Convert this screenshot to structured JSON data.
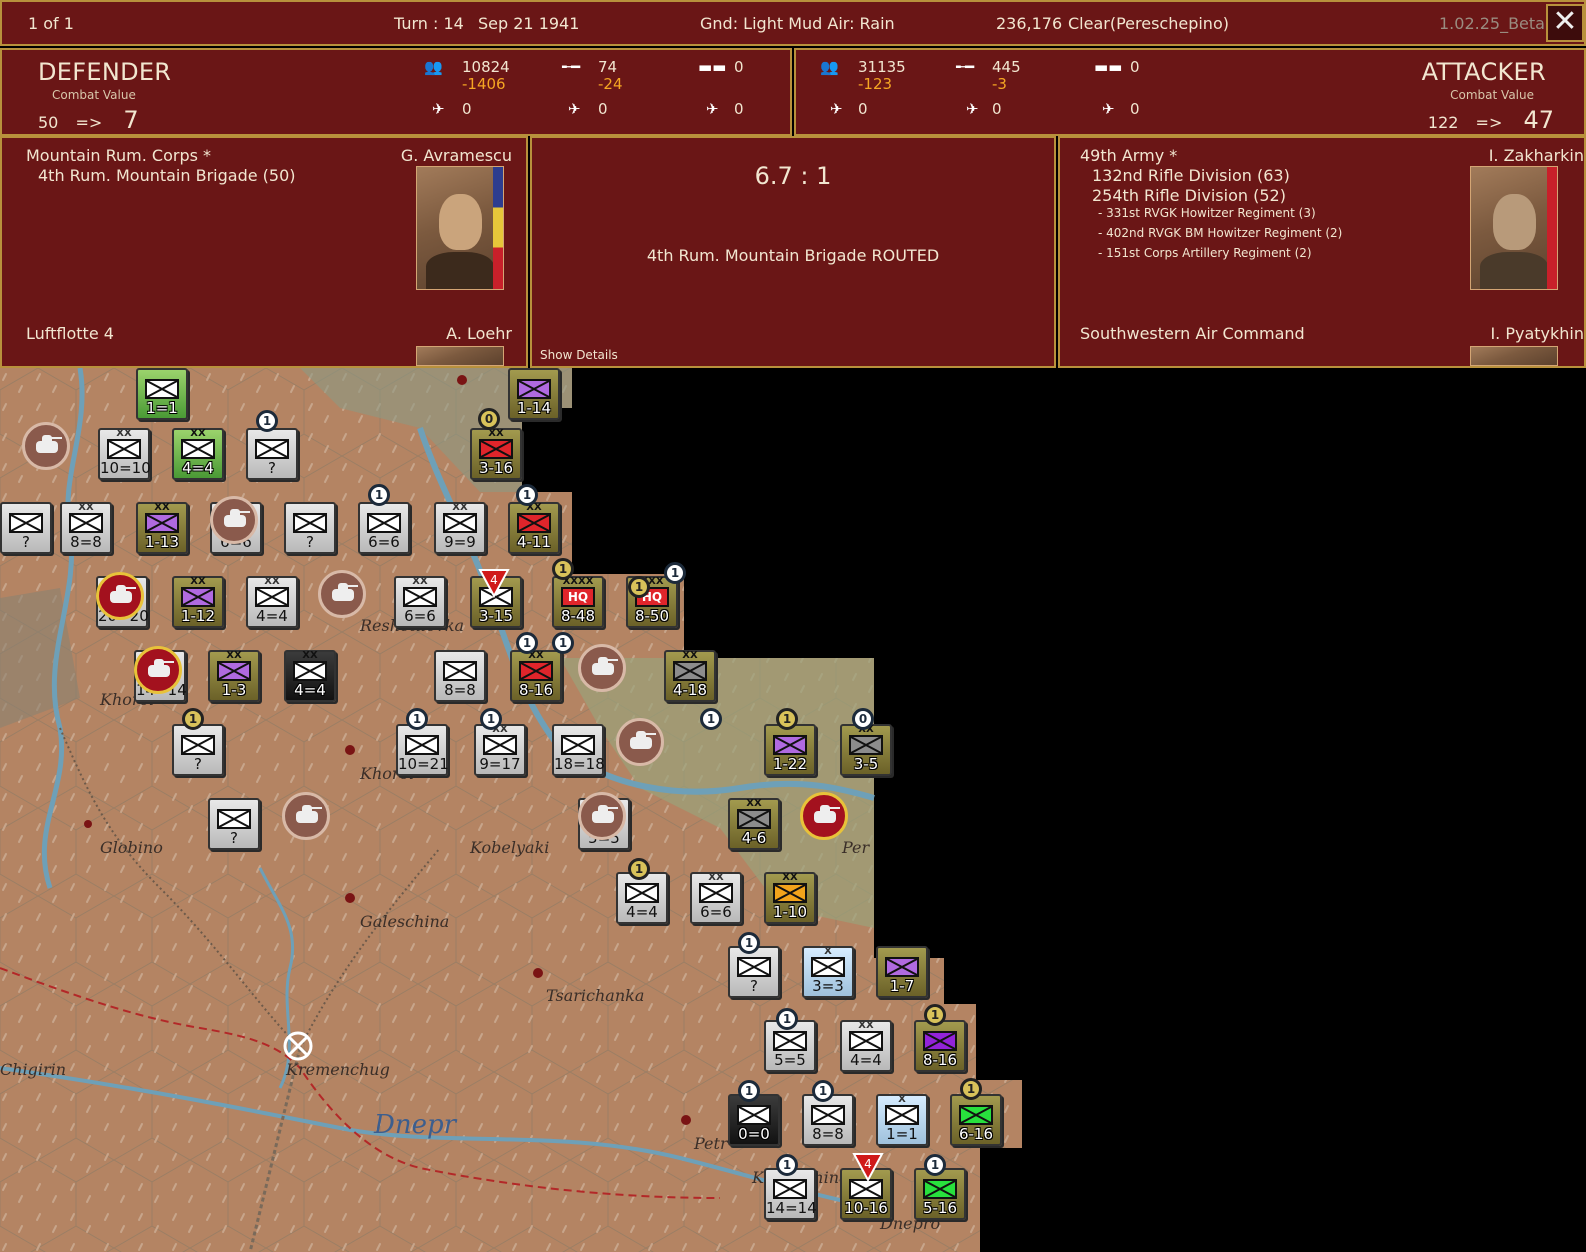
{
  "top_bar": {
    "page_info": "1 of 1",
    "turn": "Turn : 14",
    "date": "Sep 21 1941",
    "weather": "Gnd: Light Mud  Air: Rain",
    "score": "236,176",
    "location": "Clear(Pereschepino)",
    "version": "1.02.25_Beta",
    "close_label": "✕"
  },
  "defender": {
    "title": "DEFENDER",
    "cv_label": "Combat Value",
    "cv_before": "50",
    "arrow": "=>",
    "cv_after": "7",
    "men": "10824",
    "men_loss": "-1406",
    "guns": "74",
    "guns_loss": "-24",
    "afv": "0",
    "air1": "0",
    "air2": "0",
    "air3": "0"
  },
  "attacker": {
    "title": "ATTACKER",
    "cv_label": "Combat Value",
    "cv_before": "122",
    "arrow": "=>",
    "cv_after": "47",
    "men": "31135",
    "men_loss": "-123",
    "guns": "445",
    "guns_loss": "-3",
    "afv": "0",
    "air1": "0",
    "air2": "0",
    "air3": "0"
  },
  "defender_forces": {
    "hq": "Mountain Rum. Corps *",
    "commander": "G. Avramescu",
    "units": [
      "4th Rum. Mountain Brigade (50)"
    ],
    "air_hq": "Luftflotte 4",
    "air_commander": "A. Loehr"
  },
  "result": {
    "odds": "6.7 : 1",
    "outcome": "4th Rum. Mountain Brigade ROUTED",
    "details_link": "Show Details"
  },
  "attacker_forces": {
    "hq": "49th Army *",
    "commander": "I. Zakharkin",
    "units": [
      "132nd Rifle Division (63)",
      "254th Rifle Division (52)"
    ],
    "support": [
      "- 331st RVGK Howitzer Regiment (3)",
      "- 402nd RVGK BM Howitzer Regiment (2)",
      "- 151st Corps Artillery Regiment (2)"
    ],
    "air_hq": "Southwestern Air Command",
    "air_commander": "I. Pyatykhin"
  },
  "map": {
    "places": [
      "Globino",
      "Kobelyaki",
      "Galeschina",
      "Tsarichanka",
      "Kremenchug",
      "Dnepr",
      "Khorol",
      "Reshetilovka",
      "Khorol",
      "Chigirin",
      "Petr",
      "Per",
      "Kozelschina",
      "Dnepro"
    ],
    "counters": [
      {
        "value": "1=1",
        "style": "green",
        "fill": "white",
        "size": ""
      },
      {
        "value": "1-14",
        "style": "olive",
        "fill": "purple",
        "size": ""
      },
      {
        "value": "10=10",
        "style": "grey",
        "fill": "white",
        "size": "XX"
      },
      {
        "value": "4=4",
        "style": "green",
        "fill": "white",
        "size": "XX"
      },
      {
        "value": "?",
        "style": "grey",
        "fill": "white",
        "size": ""
      },
      {
        "value": "3-16",
        "style": "olive",
        "fill": "red",
        "size": "XX"
      },
      {
        "value": "?",
        "style": "grey",
        "fill": "white",
        "size": ""
      },
      {
        "value": "8=8",
        "style": "grey",
        "fill": "white",
        "size": "XX"
      },
      {
        "value": "1-13",
        "style": "olive",
        "fill": "purple",
        "size": "XX"
      },
      {
        "value": "6=6",
        "style": "grey",
        "fill": "white",
        "size": "XX"
      },
      {
        "value": "?",
        "style": "grey",
        "fill": "white",
        "size": ""
      },
      {
        "value": "6=6",
        "style": "grey",
        "fill": "white",
        "size": ""
      },
      {
        "value": "9=9",
        "style": "grey",
        "fill": "white",
        "size": "XX"
      },
      {
        "value": "4-11",
        "style": "olive",
        "fill": "red",
        "size": "XX"
      },
      {
        "value": "20=20",
        "style": "grey",
        "fill": "white",
        "size": ""
      },
      {
        "value": "1-12",
        "style": "olive",
        "fill": "purple",
        "size": "XX"
      },
      {
        "value": "4=4",
        "style": "grey",
        "fill": "white",
        "size": "XX"
      },
      {
        "value": "6=6",
        "style": "grey",
        "fill": "white",
        "size": "XX"
      },
      {
        "value": "3-15",
        "style": "olive",
        "fill": "white",
        "size": ""
      },
      {
        "value": "8-48",
        "style": "olive",
        "fill": "hq",
        "size": "XXXX"
      },
      {
        "value": "8-50",
        "style": "olive",
        "fill": "hq",
        "size": "XXX"
      },
      {
        "value": "14=14",
        "style": "grey",
        "fill": "white",
        "size": ""
      },
      {
        "value": "1-3",
        "style": "olive",
        "fill": "purple",
        "size": "XX"
      },
      {
        "value": "4=4",
        "style": "dark",
        "fill": "white",
        "size": "XX"
      },
      {
        "value": "8=8",
        "style": "grey",
        "fill": "white",
        "size": ""
      },
      {
        "value": "8-16",
        "style": "olive",
        "fill": "red",
        "size": "XX"
      },
      {
        "value": "4-18",
        "style": "olive",
        "fill": "grey",
        "size": "XX"
      },
      {
        "value": "?",
        "style": "grey",
        "fill": "white",
        "size": ""
      },
      {
        "value": "10=21",
        "style": "grey",
        "fill": "white",
        "size": ""
      },
      {
        "value": "9=17",
        "style": "grey",
        "fill": "white",
        "size": "XX"
      },
      {
        "value": "18=18",
        "style": "grey",
        "fill": "white",
        "size": ""
      },
      {
        "value": "1-22",
        "style": "olive",
        "fill": "purple",
        "size": ""
      },
      {
        "value": "3-5",
        "style": "olive",
        "fill": "grey",
        "size": "XX"
      },
      {
        "value": "?",
        "style": "grey",
        "fill": "white",
        "size": ""
      },
      {
        "value": "5=5",
        "style": "grey",
        "fill": "white",
        "size": ""
      },
      {
        "value": "4-6",
        "style": "olive",
        "fill": "grey",
        "size": "XX"
      },
      {
        "value": "4=4",
        "style": "grey",
        "fill": "white",
        "size": ""
      },
      {
        "value": "6=6",
        "style": "grey",
        "fill": "white",
        "size": "XX"
      },
      {
        "value": "1-10",
        "style": "olive",
        "fill": "orange",
        "size": "XX"
      },
      {
        "value": "?",
        "style": "grey",
        "fill": "white",
        "size": ""
      },
      {
        "value": "3=3",
        "style": "light",
        "fill": "white",
        "size": "X"
      },
      {
        "value": "1-7",
        "style": "olive",
        "fill": "purple",
        "size": ""
      },
      {
        "value": "5=5",
        "style": "grey",
        "fill": "white",
        "size": ""
      },
      {
        "value": "4=4",
        "style": "grey",
        "fill": "white",
        "size": "XX"
      },
      {
        "value": "8-16",
        "style": "olive",
        "fill": "violet",
        "size": ""
      },
      {
        "value": "0=0",
        "style": "dark",
        "fill": "white",
        "size": ""
      },
      {
        "value": "8=8",
        "style": "grey",
        "fill": "white",
        "size": ""
      },
      {
        "value": "1=1",
        "style": "light",
        "fill": "white",
        "size": "X"
      },
      {
        "value": "6-16",
        "style": "olive",
        "fill": "green",
        "size": ""
      },
      {
        "value": "14=14",
        "style": "grey",
        "fill": "white",
        "size": ""
      },
      {
        "value": "10-16",
        "style": "olive",
        "fill": "white",
        "size": ""
      },
      {
        "value": "5-16",
        "style": "olive",
        "fill": "green",
        "size": ""
      }
    ],
    "badges": [
      "1",
      "0",
      "1",
      "1",
      "1",
      "1",
      "1",
      "1",
      "1",
      "1",
      "1",
      "0",
      "1",
      "1",
      "1",
      "1",
      "1",
      "1",
      "1",
      "1",
      "1",
      "1",
      "1",
      "1",
      "4",
      "4"
    ]
  }
}
